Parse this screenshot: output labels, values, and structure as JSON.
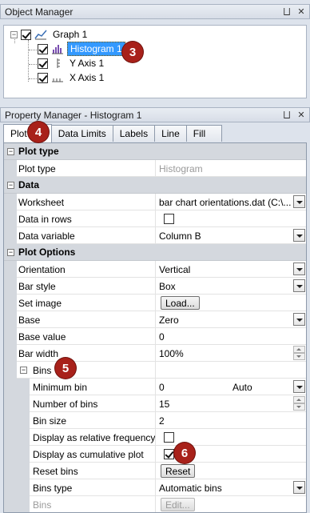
{
  "object_manager": {
    "title": "Object Manager",
    "pin_glyph": "⨆",
    "close_glyph": "✕",
    "tree": [
      {
        "label": "Graph 1",
        "checked": true,
        "icon": "graph-icon"
      },
      {
        "label": "Histogram 1",
        "checked": true,
        "icon": "histogram-icon",
        "selected": true
      },
      {
        "label": "Y Axis 1",
        "checked": true,
        "icon": "y-axis-icon"
      },
      {
        "label": "X Axis 1",
        "checked": true,
        "icon": "x-axis-icon"
      }
    ]
  },
  "property_manager": {
    "title": "Property Manager - Histogram 1",
    "tabs": [
      "Plot",
      "Data Limits",
      "Labels",
      "Line",
      "Fill"
    ],
    "active_tab": "Plot",
    "sections": {
      "plot_type": "Plot type",
      "data": "Data",
      "plot_options": "Plot Options"
    },
    "rows": {
      "plot_type": {
        "name": "Plot type",
        "value": "Histogram"
      },
      "worksheet": {
        "name": "Worksheet",
        "value": "bar chart orientations.dat (C:\\..."
      },
      "data_in_rows": {
        "name": "Data in rows",
        "checked": false
      },
      "data_variable": {
        "name": "Data variable",
        "value": "Column B"
      },
      "orientation": {
        "name": "Orientation",
        "value": "Vertical"
      },
      "bar_style": {
        "name": "Bar style",
        "value": "Box"
      },
      "set_image": {
        "name": "Set image",
        "button": "Load..."
      },
      "base": {
        "name": "Base",
        "value": "Zero"
      },
      "base_value": {
        "name": "Base value",
        "value": "0"
      },
      "bar_width": {
        "name": "Bar width",
        "value": "100%"
      },
      "bins": {
        "name": "Bins"
      },
      "minimum_bin": {
        "name": "Minimum bin",
        "value": "0",
        "extra": "Auto"
      },
      "number_of_bins": {
        "name": "Number of bins",
        "value": "15"
      },
      "bin_size": {
        "name": "Bin size",
        "value": "2"
      },
      "relative_freq": {
        "name": "Display as relative frequency",
        "checked": false
      },
      "cumulative": {
        "name": "Display as cumulative plot",
        "checked": true
      },
      "reset_bins": {
        "name": "Reset bins",
        "button": "Reset"
      },
      "bins_type": {
        "name": "Bins type",
        "value": "Automatic bins"
      },
      "bins_disabled": {
        "name": "Bins",
        "button": "Edit..."
      }
    }
  },
  "callouts": [
    "3",
    "4",
    "5",
    "6"
  ],
  "colors": {
    "callout": "#a8211a",
    "selection": "#3399ff",
    "category_row": "#d4d8de"
  }
}
